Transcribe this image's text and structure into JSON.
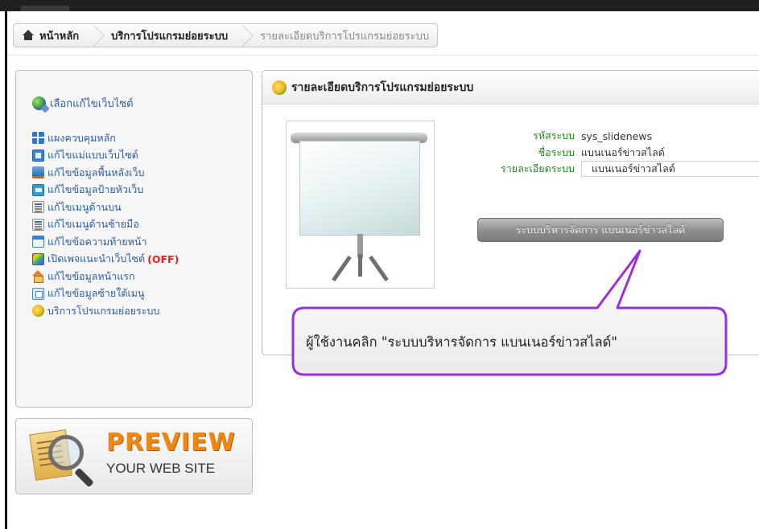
{
  "breadcrumb": {
    "home_label": "หน้าหลัก",
    "section_label": "บริการโปรแกรมย่อยระบบ",
    "current_label": "รายละเอียดบริการโปรแกรมย่อยระบบ"
  },
  "sidebar": {
    "header_label": "เลือกแก้ไขเว็บไซต์",
    "items": [
      {
        "label": "แผงควบคุมหลัก",
        "icon": "dashboard-icon"
      },
      {
        "label": "แก้ไขแม่แบบเว็บไซต์",
        "icon": "template-icon"
      },
      {
        "label": "แก้ไขข้อมูลพื้นหลังเว็บ",
        "icon": "background-icon"
      },
      {
        "label": "แก้ไขข้อมูลป้ายหัวเว็บ",
        "icon": "banner-icon"
      },
      {
        "label": "แก้ไขเมนูด้านบน",
        "icon": "top-menu-icon"
      },
      {
        "label": "แก้ไขเมนูด้านซ้ายมือ",
        "icon": "left-menu-icon"
      },
      {
        "label": "แก้ไขข้อความท้ายหน้า",
        "icon": "footer-icon"
      },
      {
        "label": "เปิดเพจแนะนำเว็บไซต์",
        "badge": "(OFF)",
        "icon": "music-icon"
      },
      {
        "label": "แก้ไขข้อมูลหน้าแรก",
        "icon": "home-icon"
      },
      {
        "label": "แก้ไขข้อมูลซ้ายใต้เมนู",
        "icon": "submenu-icon"
      },
      {
        "label": "บริการโปรแกรมย่อยระบบ",
        "icon": "module-icon"
      }
    ]
  },
  "preview": {
    "title": "PREVIEW",
    "subtitle": "YOUR WEB SITE"
  },
  "main": {
    "title": "รายละเอียดบริการโปรแกรมย่อยระบบ",
    "fields": {
      "code_label": "รหัสระบบ",
      "code_value": "sys_slidenews",
      "name_label": "ชื่อระบบ",
      "name_value": "แบนเนอร์ข่าวสไลด์",
      "detail_label": "รายละเอียดระบบ",
      "detail_value": "แบนเนอร์ข่าวสไลด์"
    },
    "manage_button_label": "ระบบบริหารจัดการ แบนเนอร์ข่าวสไลด์"
  },
  "callout": {
    "text": "ผู้ใช้งานคลิก \"ระบบบริหารจัดการ แบนเนอร์ข่าวสไลด์\"",
    "border_color": "#9b30d9"
  },
  "colors": {
    "link": "#2b5e9e",
    "field_label": "#1e8a1e",
    "off_badge": "#e81e1e",
    "preview_accent": "#f0870f"
  }
}
